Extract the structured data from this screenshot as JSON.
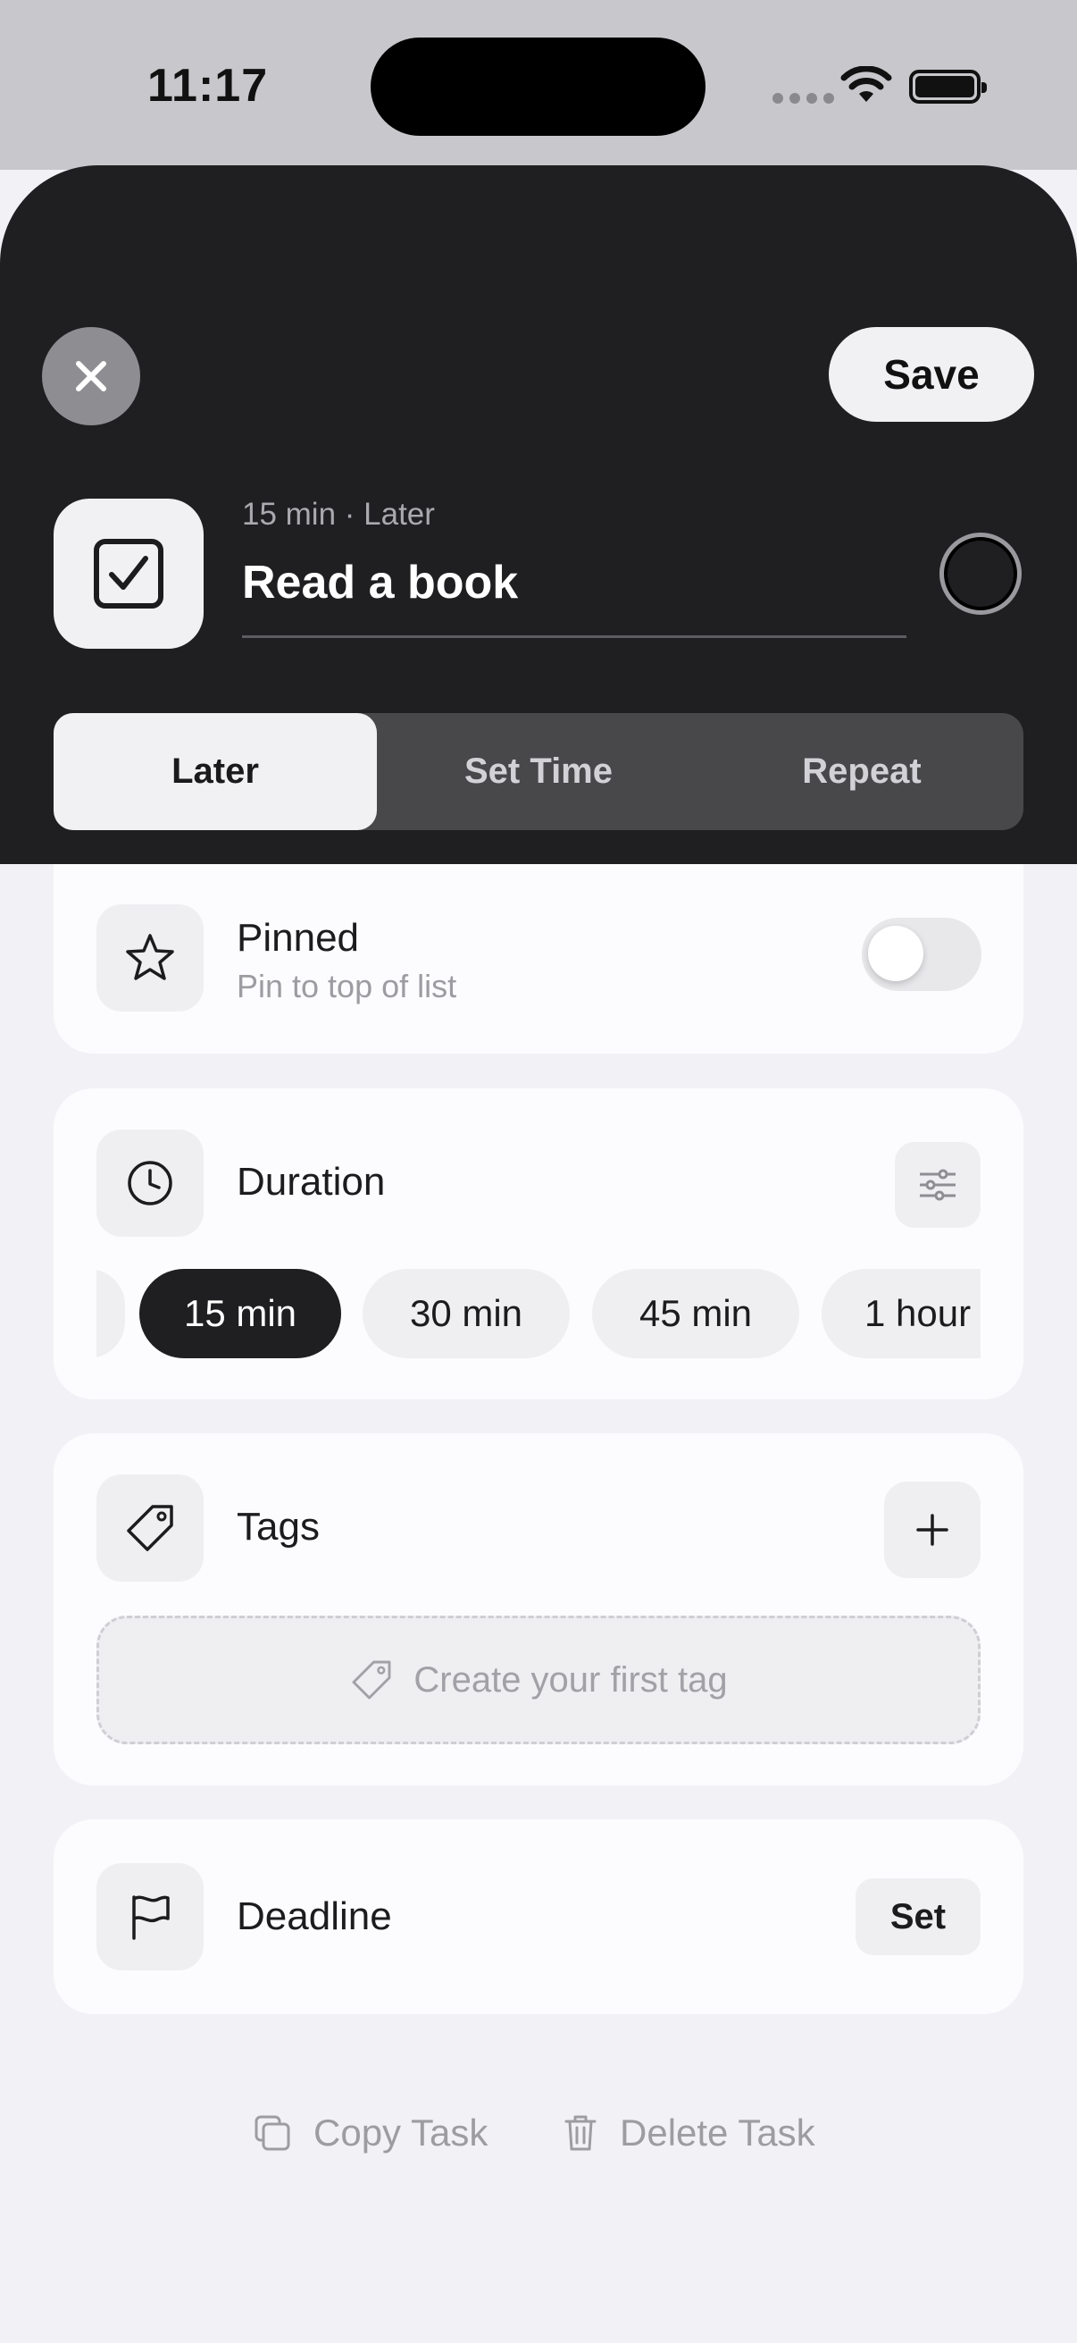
{
  "status_bar": {
    "time": "11:17"
  },
  "header": {
    "save_label": "Save",
    "meta": "15 min · Later",
    "task_title": "Read a book"
  },
  "segments": [
    {
      "label": "Later",
      "active": true
    },
    {
      "label": "Set Time",
      "active": false
    },
    {
      "label": "Repeat",
      "active": false
    }
  ],
  "pinned": {
    "title": "Pinned",
    "subtitle": "Pin to top of list",
    "enabled": false
  },
  "duration": {
    "title": "Duration",
    "options": [
      "15 min",
      "30 min",
      "45 min",
      "1 hour"
    ],
    "selected": "15 min"
  },
  "tags": {
    "title": "Tags",
    "empty_label": "Create your first tag"
  },
  "deadline": {
    "title": "Deadline",
    "button_label": "Set"
  },
  "footer": {
    "copy_label": "Copy Task",
    "delete_label": "Delete Task"
  },
  "colors": {
    "header_bg": "#1f1f21",
    "page_bg": "#f2f2f6",
    "card_bg": "#fcfcfe",
    "chip_active": "#1f1f21"
  }
}
